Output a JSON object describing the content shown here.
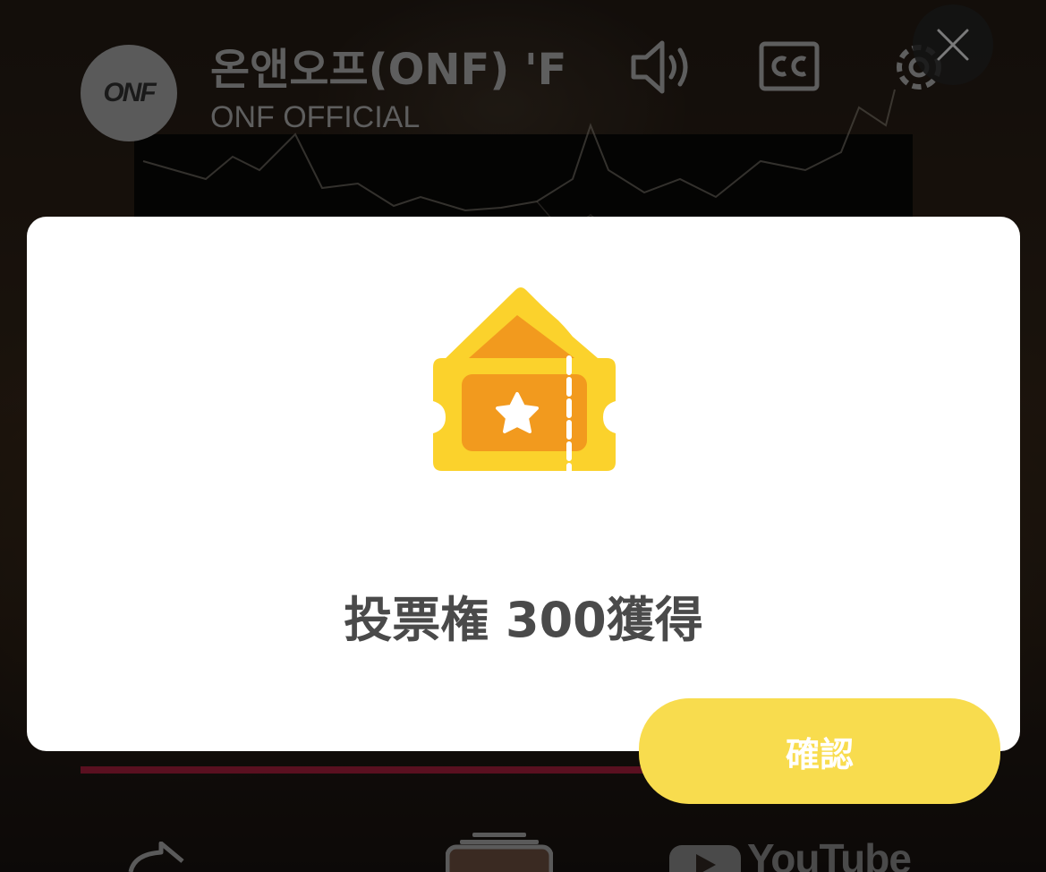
{
  "video": {
    "title": "온앤오프(ONF) 'F",
    "channel": "ONF OFFICIAL",
    "avatar_text": "ONF",
    "brand_text": "YouTube"
  },
  "modal": {
    "message": "投票権 300獲得",
    "confirm_label": "確認"
  },
  "colors": {
    "modal_bg": "#ffffff",
    "button": "#f8dc4e",
    "ticket_yellow": "#fbd22c",
    "ticket_orange": "#f29a1e",
    "text": "#4a4a4a"
  },
  "icons": [
    "volume-icon",
    "closed-captions-icon",
    "settings-icon",
    "close-icon",
    "ticket-star-icon",
    "share-icon",
    "playlist-icon",
    "youtube-logo-icon"
  ]
}
